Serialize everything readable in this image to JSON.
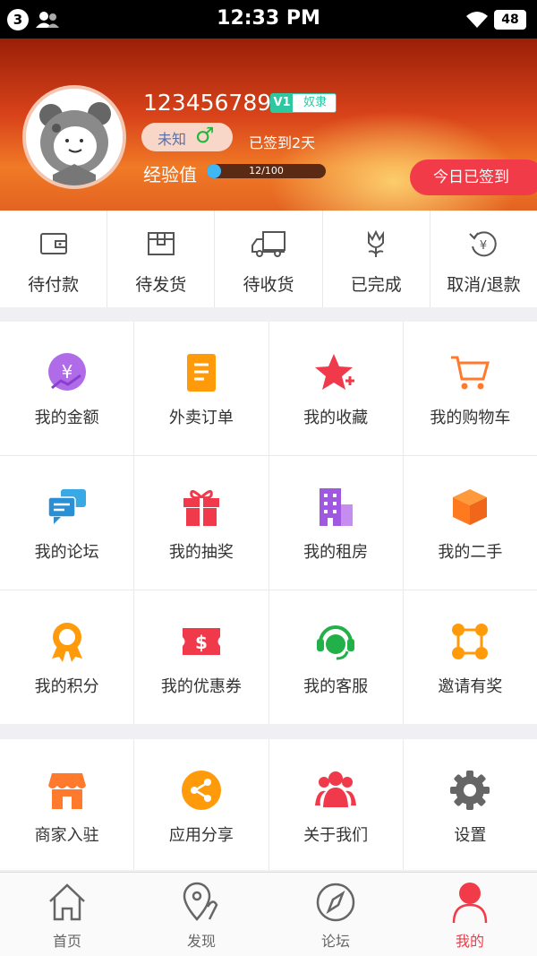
{
  "status_bar": {
    "notification_count": "3",
    "time": "12:33 PM",
    "battery": "48"
  },
  "profile": {
    "username": "123456789",
    "vip_level": "V1",
    "vip_title": "奴隶",
    "gender_text": "未知",
    "gender_symbol": "♂",
    "signed_text": "已签到2天",
    "exp_label": "经验值",
    "exp_text": "12/100",
    "exp_progress": 0.12,
    "sign_button": "今日已签到"
  },
  "orders": [
    {
      "label": "待付款",
      "icon": "wallet-icon"
    },
    {
      "label": "待发货",
      "icon": "package-icon"
    },
    {
      "label": "待收货",
      "icon": "truck-icon"
    },
    {
      "label": "已完成",
      "icon": "flower-icon"
    },
    {
      "label": "取消/退款",
      "icon": "refund-icon"
    }
  ],
  "services": [
    {
      "label": "我的金额",
      "icon": "yuan-coin-icon"
    },
    {
      "label": "外卖订单",
      "icon": "order-list-icon"
    },
    {
      "label": "我的收藏",
      "icon": "star-plus-icon"
    },
    {
      "label": "我的购物车",
      "icon": "cart-icon"
    },
    {
      "label": "我的论坛",
      "icon": "chat-bubbles-icon"
    },
    {
      "label": "我的抽奖",
      "icon": "gift-icon"
    },
    {
      "label": "我的租房",
      "icon": "building-icon"
    },
    {
      "label": "我的二手",
      "icon": "box-icon"
    },
    {
      "label": "我的积分",
      "icon": "medal-icon"
    },
    {
      "label": "我的优惠券",
      "icon": "coupon-icon"
    },
    {
      "label": "我的客服",
      "icon": "headset-icon"
    },
    {
      "label": "邀请有奖",
      "icon": "network-icon"
    }
  ],
  "more": [
    {
      "label": "商家入驻",
      "icon": "store-icon"
    },
    {
      "label": "应用分享",
      "icon": "share-icon"
    },
    {
      "label": "关于我们",
      "icon": "people-icon"
    },
    {
      "label": "设置",
      "icon": "gear-icon"
    }
  ],
  "tabs": [
    {
      "label": "首页",
      "icon": "home-icon"
    },
    {
      "label": "发现",
      "icon": "map-pin-icon"
    },
    {
      "label": "论坛",
      "icon": "compass-icon"
    },
    {
      "label": "我的",
      "icon": "user-icon",
      "active": true
    }
  ],
  "colors": {
    "accent": "#f23b48",
    "vip": "#2ec8a0"
  }
}
